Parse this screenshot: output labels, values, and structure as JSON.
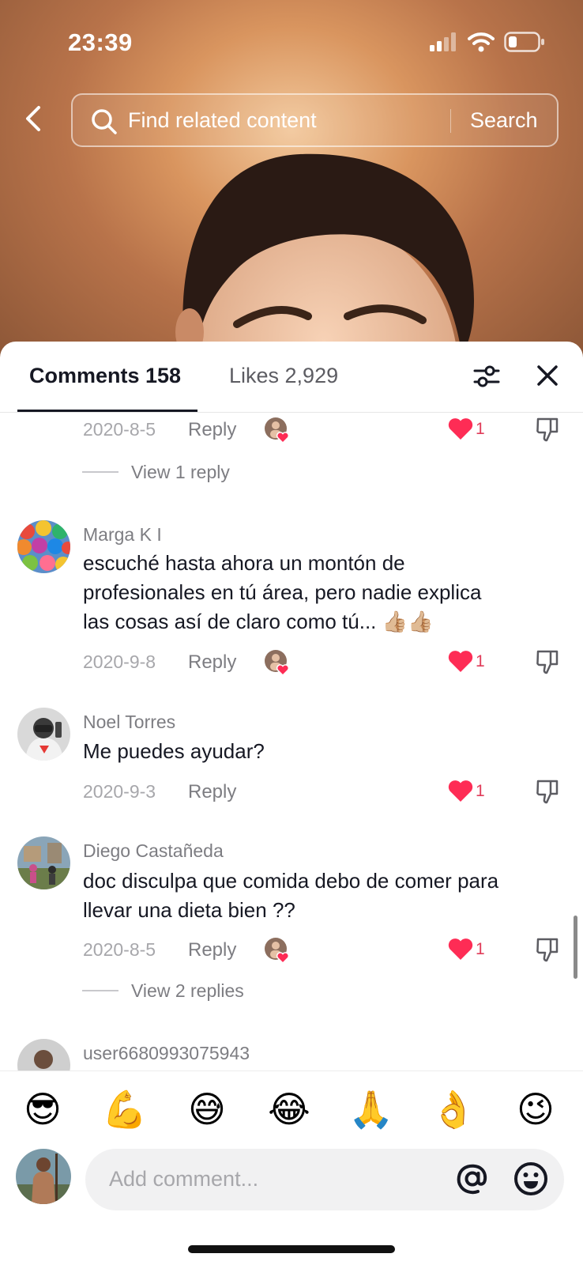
{
  "status_bar": {
    "time": "23:39"
  },
  "search": {
    "placeholder": "Find related content",
    "button_label": "Search"
  },
  "tabs": {
    "comments_label": "Comments 158",
    "likes_label": "Likes 2,929"
  },
  "comments": [
    {
      "partial": true,
      "date": "2020-8-5",
      "reply_label": "Reply",
      "creator_liked": true,
      "like_count": "1",
      "view_replies": "View 1 reply"
    },
    {
      "name": "Marga K I",
      "text_lines": [
        "escuché hasta ahora un montón de",
        "profesionales en tú área, pero nadie explica",
        "las cosas así de claro como tú... 👍🏼👍🏼"
      ],
      "date": "2020-9-8",
      "reply_label": "Reply",
      "creator_liked": true,
      "like_count": "1"
    },
    {
      "name": "Noel Torres",
      "text_lines": [
        "Me puedes ayudar?"
      ],
      "date": "2020-9-3",
      "reply_label": "Reply",
      "creator_liked": false,
      "like_count": "1"
    },
    {
      "name": "Diego Castañeda",
      "text_lines": [
        "doc disculpa que comida debo de comer para",
        "llevar una dieta bien ??"
      ],
      "date": "2020-8-5",
      "reply_label": "Reply",
      "creator_liked": true,
      "like_count": "1",
      "view_replies": "View 2 replies"
    },
    {
      "partial": true,
      "name": "user6680993075943"
    }
  ],
  "quick_emojis": [
    "😎",
    "💪",
    "😅",
    "😂",
    "🙏",
    "👌",
    "😉"
  ],
  "composer": {
    "placeholder": "Add comment..."
  },
  "colors": {
    "like_red": "#fe2c55",
    "text_primary": "#161823",
    "text_secondary": "#7d7d82"
  },
  "icons": [
    "back-arrow-icon",
    "search-icon",
    "filter-icon",
    "close-icon",
    "heart-icon",
    "dislike-icon",
    "at-icon",
    "emoji-icon",
    "signal-icon",
    "wifi-icon",
    "battery-icon"
  ]
}
